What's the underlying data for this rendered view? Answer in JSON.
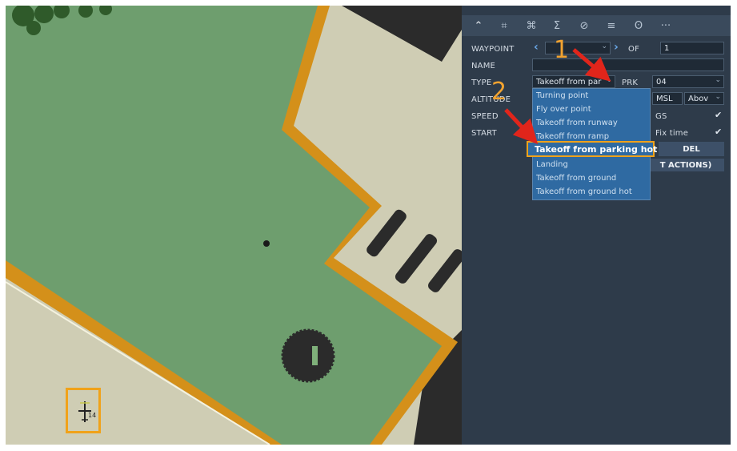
{
  "panel": {
    "tabs": [
      "route-icon",
      "target-icon",
      "command-icon",
      "sum-icon",
      "forbid-icon",
      "list-icon",
      "radio-icon",
      "more-icon"
    ],
    "waypoint_label": "WAYPOINT",
    "of_label": "OF",
    "of_value": "1",
    "name_label": "NAME",
    "type_label": "TYPE",
    "type_value": "Takeoff from par",
    "prk_label": "PRK",
    "prk_value": "04",
    "altitude_label": "ALTITUDE",
    "alt_ref": "MSL",
    "alt_mode": "Abov",
    "speed_label": "SPEED",
    "gs_label": "GS",
    "start_label": "START",
    "fix_time_label": "Fix time",
    "del_label": "DEL",
    "actions_label": "T ACTIONS)"
  },
  "dropdown": {
    "options": [
      "Turning point",
      "Fly over point",
      "Takeoff from runway",
      "Takeoff from ramp",
      "Takeoff from parking hot",
      "Landing",
      "Takeoff from ground",
      "Takeoff from ground hot"
    ],
    "selected": "Takeoff from parking hot"
  },
  "annotations": {
    "step1": "1",
    "step2": "2"
  },
  "colors": {
    "grass": "#6e9e6e",
    "taxiway_edge": "#d4901a",
    "apron": "#cfcdb4",
    "asphalt": "#2b2b2b",
    "highlight": "#f0a21a"
  }
}
